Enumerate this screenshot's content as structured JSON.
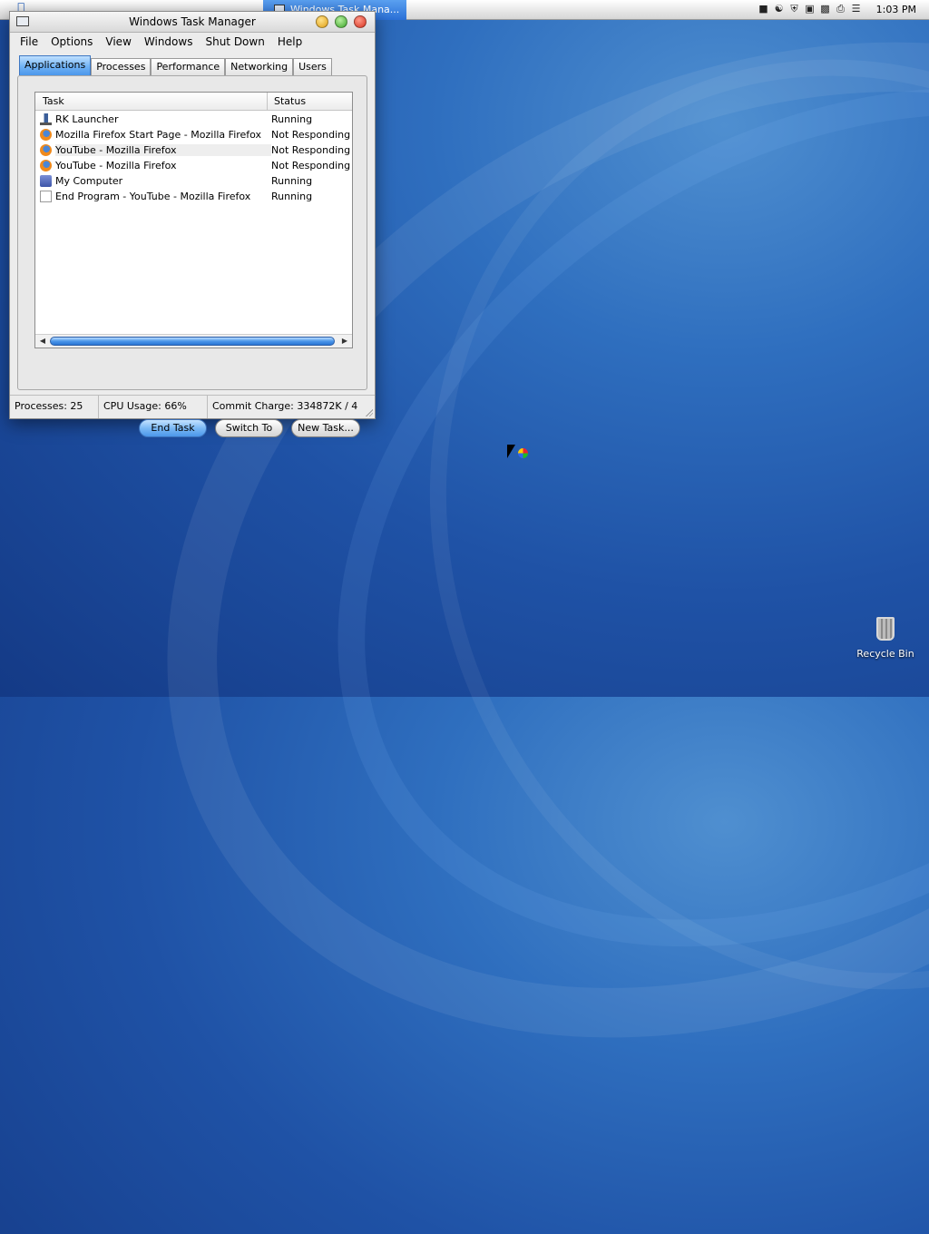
{
  "menubar": {
    "task_button_label": "Windows Task Mana...",
    "clock": "1:03 PM",
    "tray_icons": [
      "battery-icon",
      "network-icon",
      "shield-icon",
      "display-icon",
      "speech-icon",
      "printer-icon",
      "menu-icon"
    ]
  },
  "window": {
    "title": "Windows Task Manager",
    "menu": [
      "File",
      "Options",
      "View",
      "Windows",
      "Shut Down",
      "Help"
    ],
    "tabs": [
      "Applications",
      "Processes",
      "Performance",
      "Networking",
      "Users"
    ],
    "active_tab": "Applications",
    "columns": {
      "task": "Task",
      "status": "Status"
    },
    "tasks": [
      {
        "name": "RK Launcher",
        "status": "Running",
        "icon": "launcher-icon"
      },
      {
        "name": "Mozilla Firefox Start Page - Mozilla Firefox",
        "status": "Not Responding",
        "icon": "firefox-icon"
      },
      {
        "name": "YouTube - Mozilla Firefox",
        "status": "Not Responding",
        "icon": "firefox-icon"
      },
      {
        "name": "YouTube - Mozilla Firefox",
        "status": "Not Responding",
        "icon": "firefox-icon"
      },
      {
        "name": "My Computer",
        "status": "Running",
        "icon": "computer-icon"
      },
      {
        "name": "End Program - YouTube - Mozilla Firefox",
        "status": "Running",
        "icon": "document-icon"
      }
    ],
    "buttons": {
      "end_task": "End Task",
      "switch_to": "Switch To",
      "new_task": "New Task..."
    },
    "status": {
      "processes": "Processes: 25",
      "cpu": "CPU Usage: 66%",
      "commit": "Commit Charge: 334872K / 4"
    }
  },
  "desktop": {
    "recycle_bin_label": "Recycle Bin"
  },
  "colors": {
    "accent": "#4b96ea",
    "desktop": "#1f52a6"
  }
}
